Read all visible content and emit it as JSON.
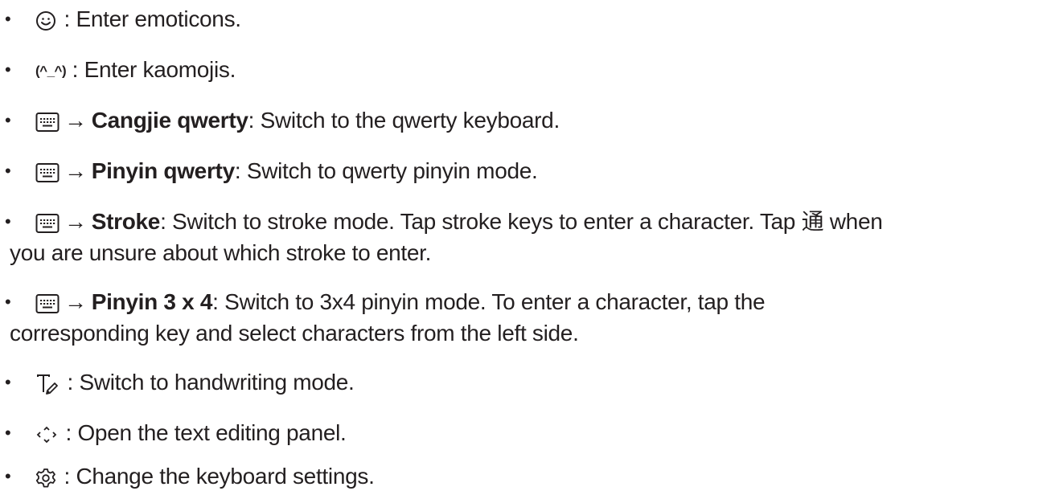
{
  "items": [
    {
      "icon": "emoticon-smiley-icon",
      "sep": " :",
      "text": " Enter emoticons."
    },
    {
      "icon": "kaomoji-icon",
      "icon_text": "(^_^)",
      "sep": " :",
      "text": " Enter kaomojis."
    },
    {
      "icon": "keyboard-icon",
      "arrow": "→",
      "bold": "Cangjie qwerty",
      "text": ": Switch to the qwerty keyboard."
    },
    {
      "icon": "keyboard-icon",
      "arrow": "→",
      "bold": "Pinyin qwerty",
      "text": ": Switch to qwerty pinyin mode."
    },
    {
      "icon": "keyboard-icon",
      "arrow": "→",
      "bold": "Stroke",
      "text": ": Switch to stroke mode. Tap stroke keys to enter a character. Tap ",
      "cjk": "通",
      "text_after": " when",
      "line2": "you are unsure about which stroke to enter."
    },
    {
      "icon": "keyboard-icon",
      "arrow": "→",
      "bold": "Pinyin 3 x 4",
      "text": ": Switch to 3x4 pinyin mode. To enter a character, tap the",
      "line2": "corresponding key and select characters from the left side."
    },
    {
      "icon": "handwriting-icon",
      "sep": " :",
      "text": " Switch to handwriting mode."
    },
    {
      "icon": "text-editing-icon",
      "sep": " :",
      "text": " Open the text editing panel."
    },
    {
      "icon": "settings-gear-icon",
      "sep": " :",
      "text": " Change the keyboard settings."
    }
  ],
  "bullet": "•"
}
